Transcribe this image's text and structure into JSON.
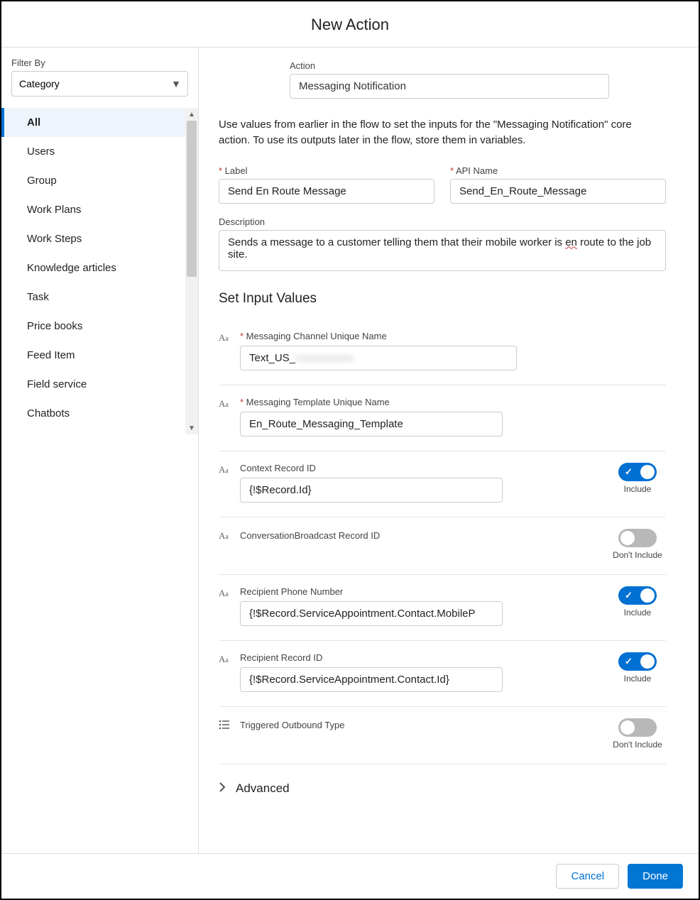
{
  "header": {
    "title": "New Action"
  },
  "sidebar": {
    "filter_label": "Filter By",
    "filter_value": "Category",
    "items": [
      {
        "label": "All",
        "selected": true
      },
      {
        "label": "Users"
      },
      {
        "label": "Group"
      },
      {
        "label": "Work Plans"
      },
      {
        "label": "Work Steps"
      },
      {
        "label": "Knowledge articles"
      },
      {
        "label": "Task"
      },
      {
        "label": "Price books"
      },
      {
        "label": "Feed Item"
      },
      {
        "label": "Field service"
      },
      {
        "label": "Chatbots"
      }
    ]
  },
  "main": {
    "action_label": "Action",
    "action_value": "Messaging Notification",
    "intro_text_pre": "Use values from earlier in the flow to set the inputs for the \"Messaging Notification\" core action. To use its outputs later in the flow, store them in variables.",
    "label_field": {
      "label": "Label",
      "value": "Send En Route Message"
    },
    "api_name_field": {
      "label": "API Name",
      "value": "Send_En_Route_Message"
    },
    "description_label": "Description",
    "description_pre": "Sends a message to a customer telling them that their mobile worker is ",
    "description_squiggle": "en",
    "description_post": " route to the job site.",
    "section_title": "Set Input Values",
    "rows": [
      {
        "icon": "Aa",
        "label": "Messaging Channel Unique Name",
        "required": true,
        "value_prefix": "Text_US_",
        "value_blur": "xxxxxxxxxxx",
        "toggle": null
      },
      {
        "icon": "Aa",
        "label": "Messaging Template Unique Name",
        "required": true,
        "value": "En_Route_Messaging_Template",
        "toggle": null
      },
      {
        "icon": "Aa",
        "label": "Context Record ID",
        "required": false,
        "value": "{!$Record.Id}",
        "toggle": "on",
        "toggle_label": "Include"
      },
      {
        "icon": "Aa",
        "label": "ConversationBroadcast Record ID",
        "required": false,
        "no_input": true,
        "toggle": "off",
        "toggle_label": "Don't Include"
      },
      {
        "icon": "Aa",
        "label": "Recipient Phone Number",
        "required": false,
        "value": "{!$Record.ServiceAppointment.Contact.MobileP",
        "toggle": "on",
        "toggle_label": "Include"
      },
      {
        "icon": "Aa",
        "label": "Recipient Record ID",
        "required": false,
        "value": "{!$Record.ServiceAppointment.Contact.Id}",
        "toggle": "on",
        "toggle_label": "Include"
      },
      {
        "icon": "list",
        "label": "Triggered Outbound Type",
        "required": false,
        "no_input": true,
        "toggle": "off",
        "toggle_label": "Don't Include"
      }
    ],
    "advanced_label": "Advanced"
  },
  "footer": {
    "cancel": "Cancel",
    "done": "Done"
  }
}
